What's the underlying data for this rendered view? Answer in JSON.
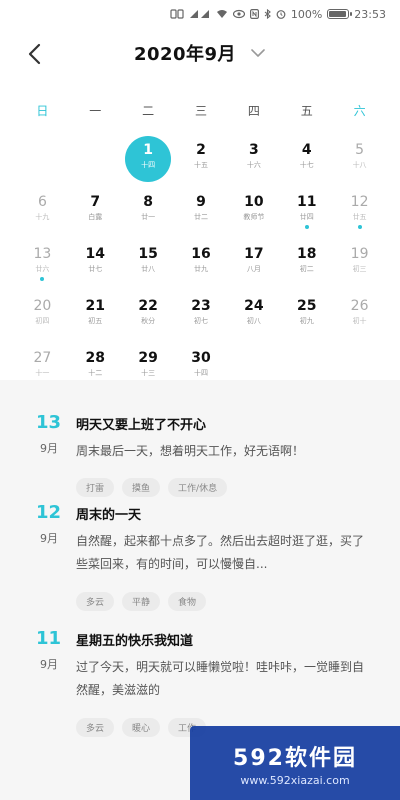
{
  "status_bar": {
    "battery": "100%",
    "time": "23:53",
    "battery_level": 1.0
  },
  "header": {
    "month": "2020年9月"
  },
  "weekdays": [
    "日",
    "一",
    "二",
    "三",
    "四",
    "五",
    "六"
  ],
  "calendar": {
    "days": [
      {
        "col": 2,
        "num": "1",
        "lunar": "十四",
        "selected": true,
        "dot": false
      },
      {
        "col": 3,
        "num": "2",
        "lunar": "十五",
        "dot": false
      },
      {
        "col": 4,
        "num": "3",
        "lunar": "十六",
        "dot": false
      },
      {
        "col": 5,
        "num": "4",
        "lunar": "十七",
        "dot": false
      },
      {
        "col": 6,
        "num": "5",
        "lunar": "十八",
        "dot": false
      },
      {
        "col": 0,
        "num": "6",
        "lunar": "十九",
        "dot": false
      },
      {
        "col": 1,
        "num": "7",
        "lunar": "白露",
        "dot": false
      },
      {
        "col": 2,
        "num": "8",
        "lunar": "廿一",
        "dot": false
      },
      {
        "col": 3,
        "num": "9",
        "lunar": "廿二",
        "dot": false
      },
      {
        "col": 4,
        "num": "10",
        "lunar": "教师节",
        "dot": false
      },
      {
        "col": 5,
        "num": "11",
        "lunar": "廿四",
        "dot": true
      },
      {
        "col": 6,
        "num": "12",
        "lunar": "廿五",
        "dot": true
      },
      {
        "col": 0,
        "num": "13",
        "lunar": "廿六",
        "dot": true
      },
      {
        "col": 1,
        "num": "14",
        "lunar": "廿七",
        "dot": false
      },
      {
        "col": 2,
        "num": "15",
        "lunar": "廿八",
        "dot": false
      },
      {
        "col": 3,
        "num": "16",
        "lunar": "廿九",
        "dot": false
      },
      {
        "col": 4,
        "num": "17",
        "lunar": "八月",
        "dot": false
      },
      {
        "col": 5,
        "num": "18",
        "lunar": "初二",
        "dot": false
      },
      {
        "col": 6,
        "num": "19",
        "lunar": "初三",
        "dot": false
      },
      {
        "col": 0,
        "num": "20",
        "lunar": "初四",
        "dot": false
      },
      {
        "col": 1,
        "num": "21",
        "lunar": "初五",
        "dot": false
      },
      {
        "col": 2,
        "num": "22",
        "lunar": "秋分",
        "dot": false
      },
      {
        "col": 3,
        "num": "23",
        "lunar": "初七",
        "dot": false
      },
      {
        "col": 4,
        "num": "24",
        "lunar": "初八",
        "dot": false
      },
      {
        "col": 5,
        "num": "25",
        "lunar": "初九",
        "dot": false
      },
      {
        "col": 6,
        "num": "26",
        "lunar": "初十",
        "dot": false
      },
      {
        "col": 0,
        "num": "27",
        "lunar": "十一",
        "dot": false
      },
      {
        "col": 1,
        "num": "28",
        "lunar": "十二",
        "dot": false
      },
      {
        "col": 2,
        "num": "29",
        "lunar": "十三",
        "dot": false
      },
      {
        "col": 3,
        "num": "30",
        "lunar": "十四",
        "dot": false
      }
    ]
  },
  "entries": [
    {
      "day": "13",
      "month": "9月",
      "title": "明天又要上班了不开心",
      "body": "周末最后一天，想着明天工作，好无语啊！",
      "tags": [
        "打雷",
        "摸鱼",
        "工作/休息"
      ]
    },
    {
      "day": "12",
      "month": "9月",
      "title": "周末的一天",
      "body": "自然醒，起来都十点多了。然后出去超时逛了逛，买了些菜回来，有的时间，可以慢慢自...",
      "tags": [
        "多云",
        "平静",
        "食物"
      ]
    },
    {
      "day": "11",
      "month": "9月",
      "title": "星期五的快乐我知道",
      "body": "过了今天，明天就可以睡懒觉啦！哇咔咔，一觉睡到自然醒，美滋滋的",
      "tags": [
        "多云",
        "暖心",
        "工作"
      ]
    }
  ],
  "watermark": {
    "brand": "592软件园",
    "url": "www.592xiazai.com"
  },
  "colors": {
    "accent": "#2ec4d6"
  }
}
